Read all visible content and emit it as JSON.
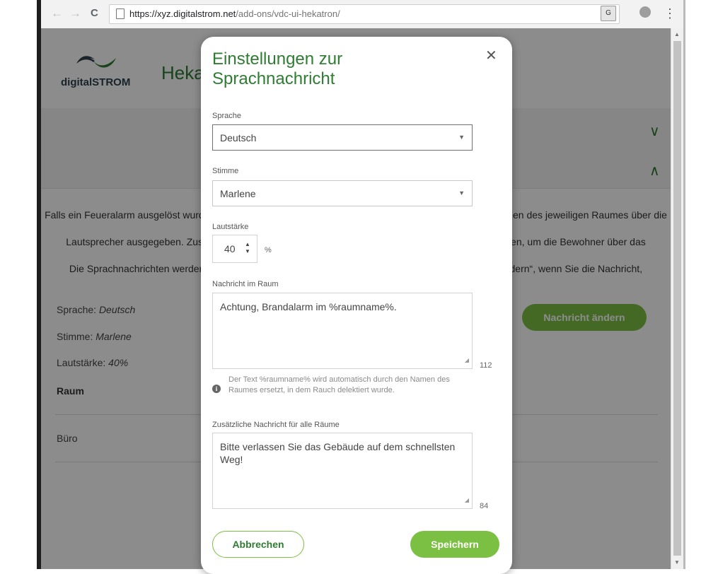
{
  "browser": {
    "back_icon": "←",
    "forward_icon": "→",
    "reload_icon": "C",
    "url_host": "https://xyz.digitalstrom.net",
    "url_path": "/add-ons/vdc-ui-hekatron/",
    "translate_icon": "G",
    "menu_icon": "⋮"
  },
  "page": {
    "logo_part1": "digital",
    "logo_part2": "STROM",
    "title": "Hekatron",
    "chevron_down": "∨",
    "chevron_up": "∧",
    "intro_line1": "Falls ein Feueralarm ausgelöst wurde, wird in jedem betroffenen Raum eine Sprachnachricht mit dem Namen des jeweiligen Raumes über die Sonos",
    "intro_line2": "Lautsprecher ausgegeben. Zusätzlich kann eine allgemeine Nachricht für alle Räume eingestellt werden, um die Bewohner über das",
    "intro_line3": "Die Sprachnachrichten werden in der gewählten Sprache ausgegeben. Klicken Sie auf „Nachricht ändern“, wenn Sie die Nachricht,",
    "sprache_label": "Sprache: ",
    "sprache_value": "Deutsch",
    "stimme_label": "Stimme: ",
    "stimme_value": "Marlene",
    "lautstaerke_label": "Lautstärke: ",
    "lautstaerke_value": "40%",
    "change_button": "Nachricht ändern",
    "room_header": "Raum",
    "rooms": [
      "Büro"
    ]
  },
  "modal": {
    "title": "Einstellungen zur Sprachnachricht",
    "close_icon": "✕",
    "language_label": "Sprache",
    "language_value": "Deutsch",
    "voice_label": "Stimme",
    "voice_value": "Marlene",
    "volume_label": "Lautstärke",
    "volume_value": "40",
    "volume_unit": "%",
    "room_message_label": "Nachricht im Raum",
    "room_message_value": "Achtung, Brandalarm im %raumname%.",
    "room_message_remaining": "112",
    "hint_icon": "i",
    "hint_text": "Der Text %raumname% wird automatisch durch den Namen des Raumes ersetzt, in dem Rauch delektiert wurde.",
    "all_rooms_label": "Zusätzliche Nachricht für alle Räume",
    "all_rooms_value": "Bitte verlassen Sie das Gebäude auf dem schnellsten Weg!",
    "all_rooms_remaining": "84",
    "cancel_button": "Abbrechen",
    "save_button": "Speichern"
  },
  "colors": {
    "brand_green": "#2e7d32",
    "accent_green": "#7cc043"
  }
}
